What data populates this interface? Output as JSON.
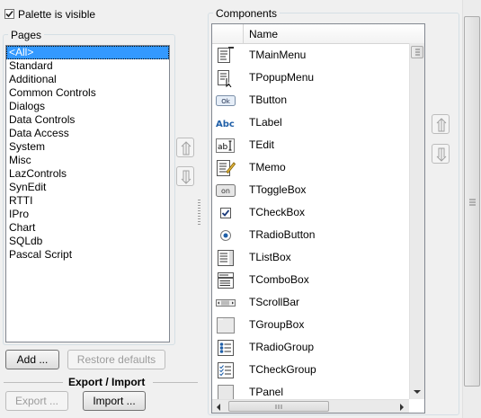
{
  "palette_visible": {
    "label": "Palette is visible",
    "checked": true
  },
  "pages": {
    "title": "Pages",
    "items": [
      "<All>",
      "Standard",
      "Additional",
      "Common Controls",
      "Dialogs",
      "Data Controls",
      "Data Access",
      "System",
      "Misc",
      "LazControls",
      "SynEdit",
      "RTTI",
      "IPro",
      "Chart",
      "SQLdb",
      "Pascal Script"
    ],
    "selected": "<All>"
  },
  "buttons": {
    "add": "Add ...",
    "restore_defaults": "Restore defaults",
    "export": "Export ...",
    "import": "Import ..."
  },
  "export_import_title": "Export / Import",
  "components": {
    "title": "Components",
    "column_header": "Name",
    "rows": [
      {
        "name": "TMainMenu",
        "icon": "main-menu-icon"
      },
      {
        "name": "TPopupMenu",
        "icon": "popup-menu-icon"
      },
      {
        "name": "TButton",
        "icon": "button-icon",
        "icon_text": "Ok"
      },
      {
        "name": "TLabel",
        "icon": "label-icon",
        "icon_text": "Abc"
      },
      {
        "name": "TEdit",
        "icon": "edit-icon",
        "icon_text": "ab"
      },
      {
        "name": "TMemo",
        "icon": "memo-icon"
      },
      {
        "name": "TToggleBox",
        "icon": "togglebox-icon",
        "icon_text": "on"
      },
      {
        "name": "TCheckBox",
        "icon": "checkbox-icon"
      },
      {
        "name": "TRadioButton",
        "icon": "radiobutton-icon"
      },
      {
        "name": "TListBox",
        "icon": "listbox-icon"
      },
      {
        "name": "TComboBox",
        "icon": "combobox-icon"
      },
      {
        "name": "TScrollBar",
        "icon": "scrollbar-icon"
      },
      {
        "name": "TGroupBox",
        "icon": "groupbox-icon"
      },
      {
        "name": "TRadioGroup",
        "icon": "radiogroup-icon"
      },
      {
        "name": "TCheckGroup",
        "icon": "checkgroup-icon"
      },
      {
        "name": "TPanel",
        "icon": "panel-icon"
      }
    ]
  },
  "colors": {
    "selection": "#3399ff",
    "window_bg": "#f0f0f0",
    "icon_blue": "#1f5fa8"
  }
}
